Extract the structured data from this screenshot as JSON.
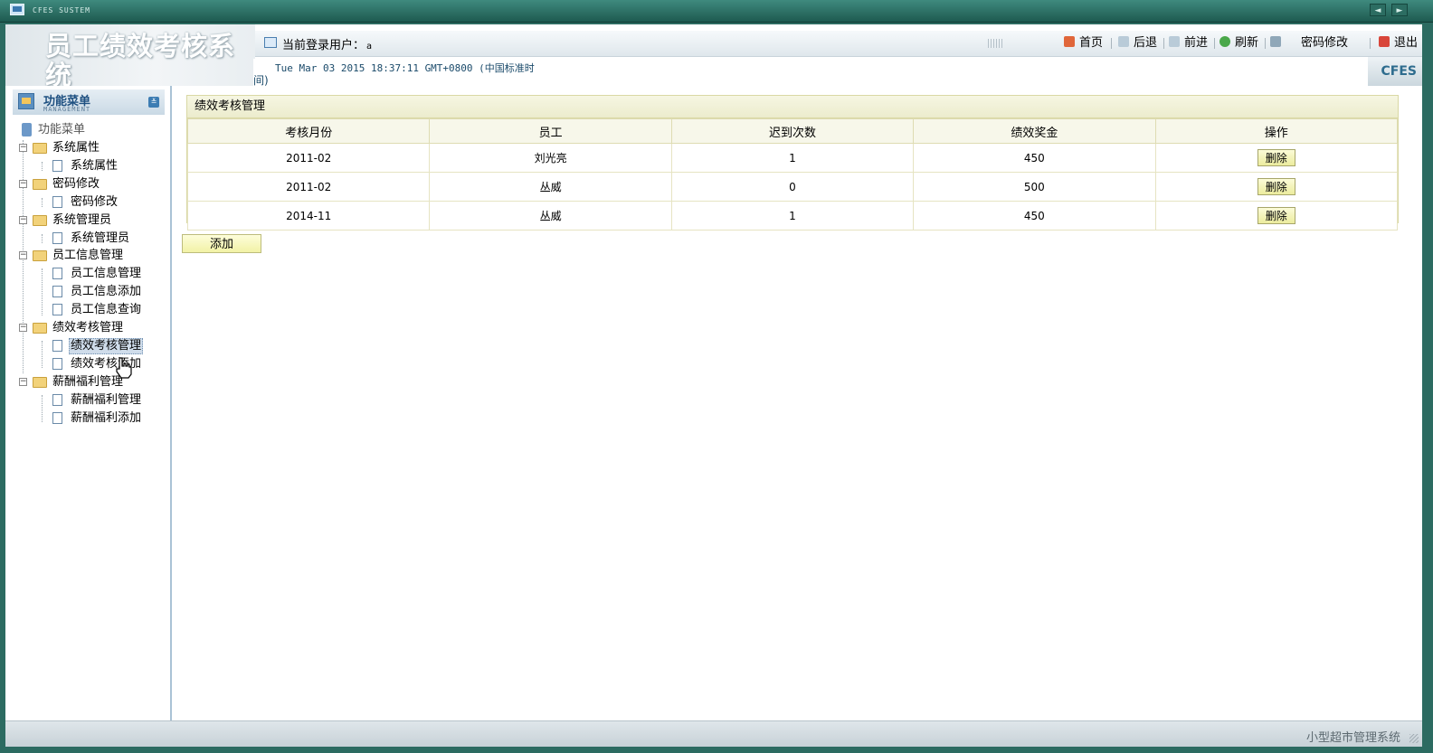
{
  "window": {
    "title": "CFES SUSTEM",
    "nav_prev": "◄",
    "nav_next": "►"
  },
  "header": {
    "system_title": "员工绩效考核系统",
    "current_user_label": "当前登录用户：",
    "current_user": "a",
    "datetime_line1": "Tue Mar 03 2015 18:37:11 GMT+0800 (中国标准时",
    "datetime_line2": "间)",
    "brand": "CFES",
    "toolbar": {
      "home": "首页",
      "back": "后退",
      "forward": "前进",
      "refresh": "刷新",
      "change_password": "密码修改",
      "logout": "退出"
    }
  },
  "menu": {
    "title": "功能菜单",
    "subtitle": "MANAGEMENT",
    "root": "功能菜单",
    "groups": [
      {
        "label": "系统属性",
        "items": [
          "系统属性"
        ]
      },
      {
        "label": "密码修改",
        "items": [
          "密码修改"
        ]
      },
      {
        "label": "系统管理员",
        "items": [
          "系统管理员"
        ]
      },
      {
        "label": "员工信息管理",
        "items": [
          "员工信息管理",
          "员工信息添加",
          "员工信息查询"
        ]
      },
      {
        "label": "绩效考核管理",
        "items": [
          "绩效考核管理",
          "绩效考核添加"
        ]
      },
      {
        "label": "薪酬福利管理",
        "items": [
          "薪酬福利管理",
          "薪酬福利添加"
        ]
      }
    ],
    "selected": "绩效考核管理"
  },
  "main": {
    "panel_title": "绩效考核管理",
    "columns": [
      "考核月份",
      "员工",
      "迟到次数",
      "绩效奖金",
      "操作"
    ],
    "rows": [
      {
        "month": "2011-02",
        "employee": "刘光亮",
        "late": "1",
        "bonus": "450",
        "action": "删除"
      },
      {
        "month": "2011-02",
        "employee": "丛威",
        "late": "0",
        "bonus": "500",
        "action": "删除"
      },
      {
        "month": "2014-11",
        "employee": "丛威",
        "late": "1",
        "bonus": "450",
        "action": "删除"
      }
    ],
    "add_button": "添加"
  },
  "status": {
    "text": "小型超市管理系统"
  },
  "colors": {
    "accent": "#2c6b61",
    "panel_border": "#d9d8a4",
    "button_fill": "#ecec9e"
  }
}
